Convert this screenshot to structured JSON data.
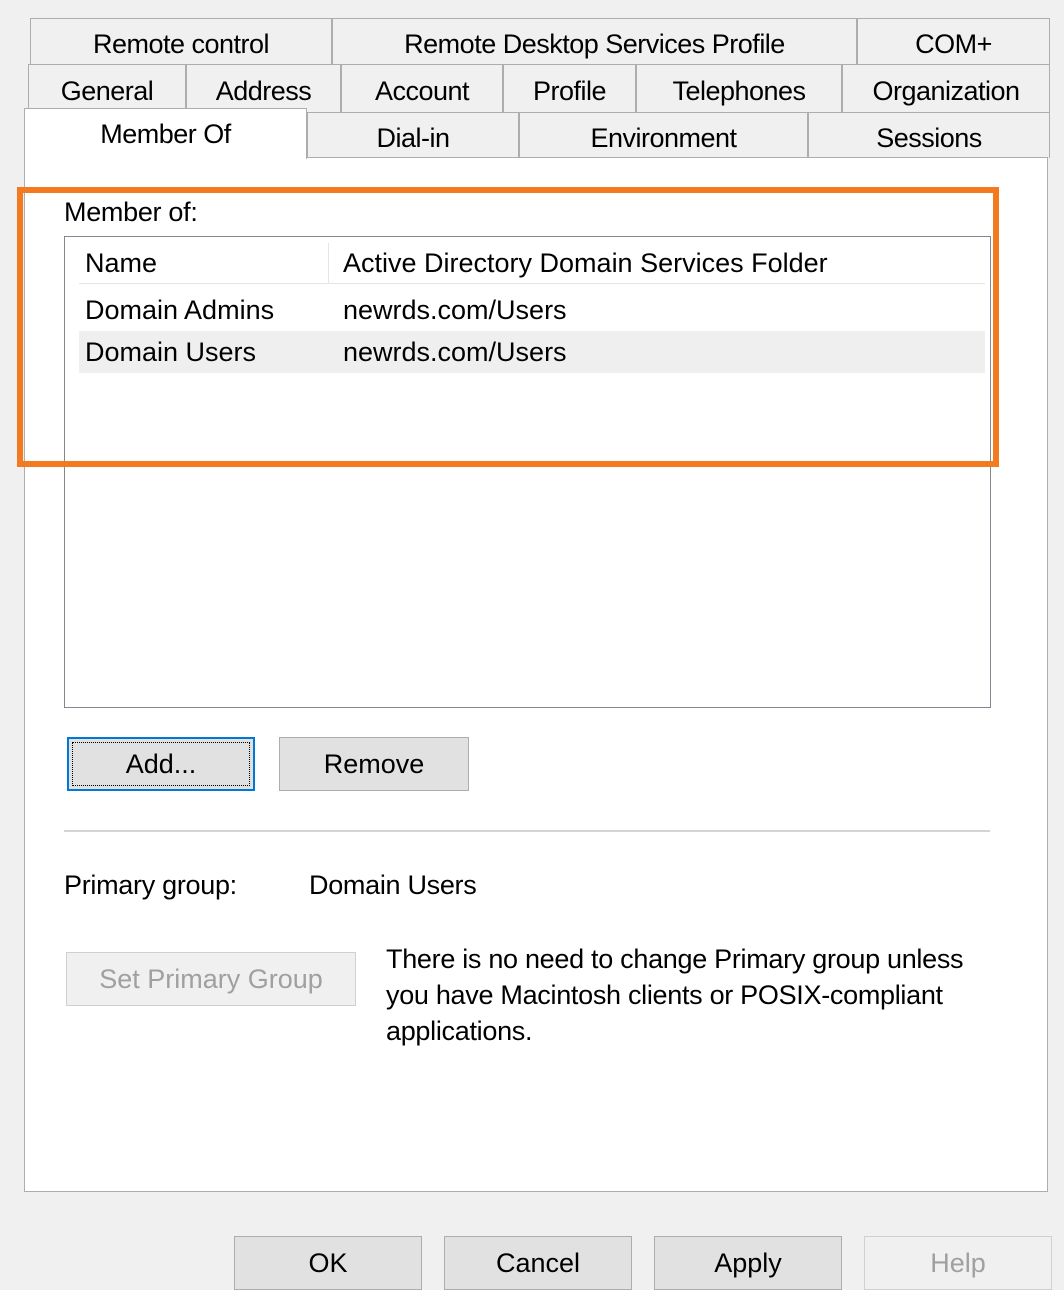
{
  "tabs": {
    "row1": [
      "Remote control",
      "Remote Desktop Services Profile",
      "COM+"
    ],
    "row2": [
      "General",
      "Address",
      "Account",
      "Profile",
      "Telephones",
      "Organization"
    ],
    "row3": [
      "Member Of",
      "Dial-in",
      "Environment",
      "Sessions"
    ]
  },
  "member_of": {
    "label": "Member of:",
    "columns": [
      "Name",
      "Active Directory Domain Services Folder"
    ],
    "rows": [
      {
        "name": "Domain Admins",
        "folder": "newrds.com/Users"
      },
      {
        "name": "Domain Users",
        "folder": "newrds.com/Users"
      }
    ]
  },
  "buttons": {
    "add": "Add...",
    "remove": "Remove",
    "set_primary_group": "Set Primary Group"
  },
  "primary_group": {
    "label": "Primary group:",
    "value": "Domain Users",
    "note_lines": [
      "There is no need to change Primary group unless",
      "you have Macintosh clients or POSIX-compliant",
      "applications."
    ]
  },
  "dialog_buttons": {
    "ok": "OK",
    "cancel": "Cancel",
    "apply": "Apply",
    "help": "Help"
  },
  "colors": {
    "highlight_box": "#f47a20",
    "focus_border": "#0078d7"
  }
}
